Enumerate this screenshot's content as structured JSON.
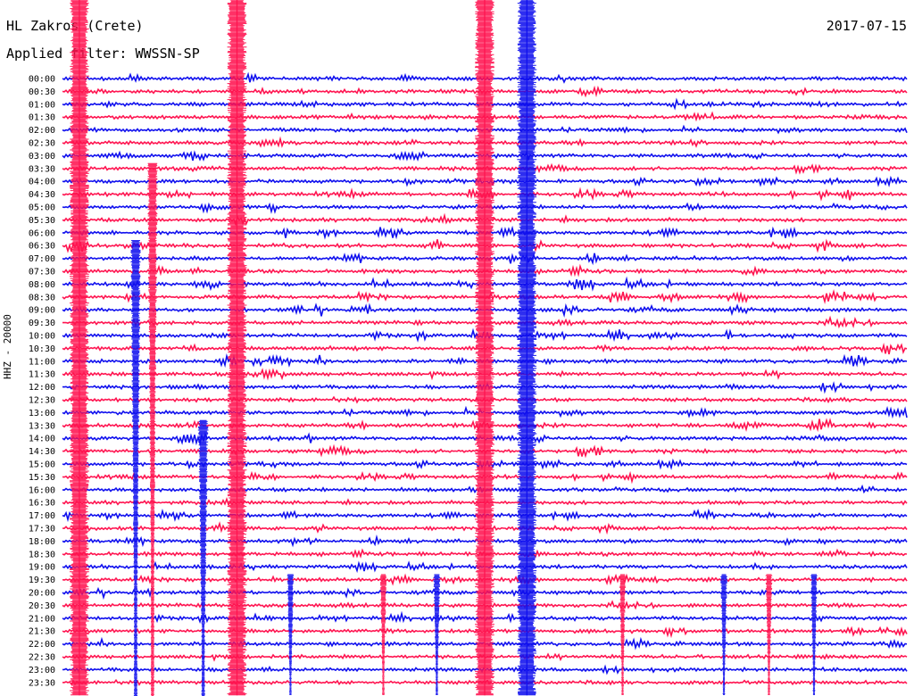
{
  "header": {
    "station": "HL Zakros (Crete)",
    "date": "2017-07-15",
    "filter": "Applied filter: WWSSN-SP",
    "channel_label": "HHZ - 20000"
  },
  "colors": {
    "row_a": "#1010ee",
    "row_b": "#ff1450",
    "axis": "#000000"
  },
  "chart_data": {
    "type": "line",
    "title": "HL Zakros (Crete)",
    "subtitle": "Applied filter: WWSSN-SP",
    "date": "2017-07-15",
    "ylabel": "HHZ - 20000",
    "xlabel": "",
    "row_duration_minutes": 30,
    "rows": [
      "00:00",
      "00:30",
      "01:00",
      "01:30",
      "02:00",
      "02:30",
      "03:00",
      "03:30",
      "04:00",
      "04:30",
      "05:00",
      "05:30",
      "06:00",
      "06:30",
      "07:00",
      "07:30",
      "08:00",
      "08:30",
      "09:00",
      "09:30",
      "10:00",
      "10:30",
      "11:00",
      "11:30",
      "12:00",
      "12:30",
      "13:00",
      "13:30",
      "14:00",
      "14:30",
      "15:00",
      "15:30",
      "16:00",
      "16:30",
      "17:00",
      "17:30",
      "18:00",
      "18:30",
      "19:00",
      "19:30",
      "20:00",
      "20:30",
      "21:00",
      "21:30",
      "22:00",
      "22:30",
      "23:00",
      "23:30"
    ],
    "row_colors_cycle": [
      "blue",
      "red"
    ],
    "events": [
      {
        "minute_in_row": 0.6,
        "start_row": "00:00",
        "amplitude": "saturated",
        "duration_rows": 48
      },
      {
        "minute_in_row": 2.6,
        "start_row": "07:00",
        "amplitude": "large",
        "duration_rows": 41
      },
      {
        "minute_in_row": 3.2,
        "start_row": "04:00",
        "amplitude": "large",
        "duration_rows": 44
      },
      {
        "minute_in_row": 5.0,
        "start_row": "14:00",
        "amplitude": "large",
        "duration_rows": 34
      },
      {
        "minute_in_row": 6.2,
        "start_row": "00:00",
        "amplitude": "saturated",
        "duration_rows": 48
      },
      {
        "minute_in_row": 8.1,
        "start_row": "20:00",
        "amplitude": "medium",
        "duration_rows": 8
      },
      {
        "minute_in_row": 11.4,
        "start_row": "20:00",
        "amplitude": "medium",
        "duration_rows": 8
      },
      {
        "minute_in_row": 13.3,
        "start_row": "20:00",
        "amplitude": "medium",
        "duration_rows": 8
      },
      {
        "minute_in_row": 15.0,
        "start_row": "00:00",
        "amplitude": "saturated",
        "duration_rows": 48
      },
      {
        "minute_in_row": 16.5,
        "start_row": "00:00",
        "amplitude": "saturated",
        "duration_rows": 48
      },
      {
        "minute_in_row": 19.9,
        "start_row": "20:00",
        "amplitude": "medium",
        "duration_rows": 8
      },
      {
        "minute_in_row": 23.5,
        "start_row": "20:00",
        "amplitude": "medium",
        "duration_rows": 8
      },
      {
        "minute_in_row": 25.1,
        "start_row": "20:00",
        "amplitude": "medium",
        "duration_rows": 8
      },
      {
        "minute_in_row": 26.7,
        "start_row": "20:00",
        "amplitude": "medium",
        "duration_rows": 8
      }
    ]
  }
}
